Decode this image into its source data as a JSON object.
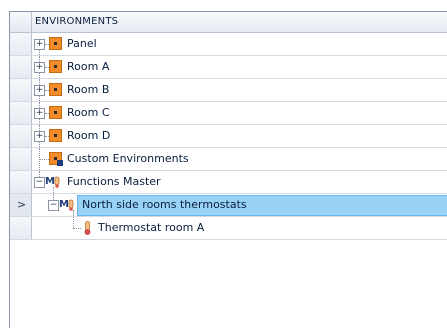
{
  "header": {
    "title": "ENVIRONMENTS"
  },
  "rows": [
    {
      "label": "Panel",
      "icon": "environment-icon",
      "expander": "+"
    },
    {
      "label": "Room A",
      "icon": "environment-icon",
      "expander": "+"
    },
    {
      "label": "Room B",
      "icon": "environment-icon",
      "expander": "+"
    },
    {
      "label": "Room C",
      "icon": "environment-icon",
      "expander": "+"
    },
    {
      "label": "Room D",
      "icon": "environment-icon",
      "expander": "+"
    },
    {
      "label": "Custom Environments",
      "icon": "custom-environment-icon"
    },
    {
      "label": "Functions Master",
      "icon": "functions-master-icon",
      "expander": "−"
    },
    {
      "label": "North side rooms thermostats",
      "icon": "functions-group-icon",
      "expander": "−",
      "selected": true
    },
    {
      "label": "Thermostat room A",
      "icon": "thermostat-icon"
    }
  ],
  "current_row_indicator": ">",
  "colors": {
    "selection": "#99d2f7",
    "environment_icon": "#f08c2a"
  }
}
